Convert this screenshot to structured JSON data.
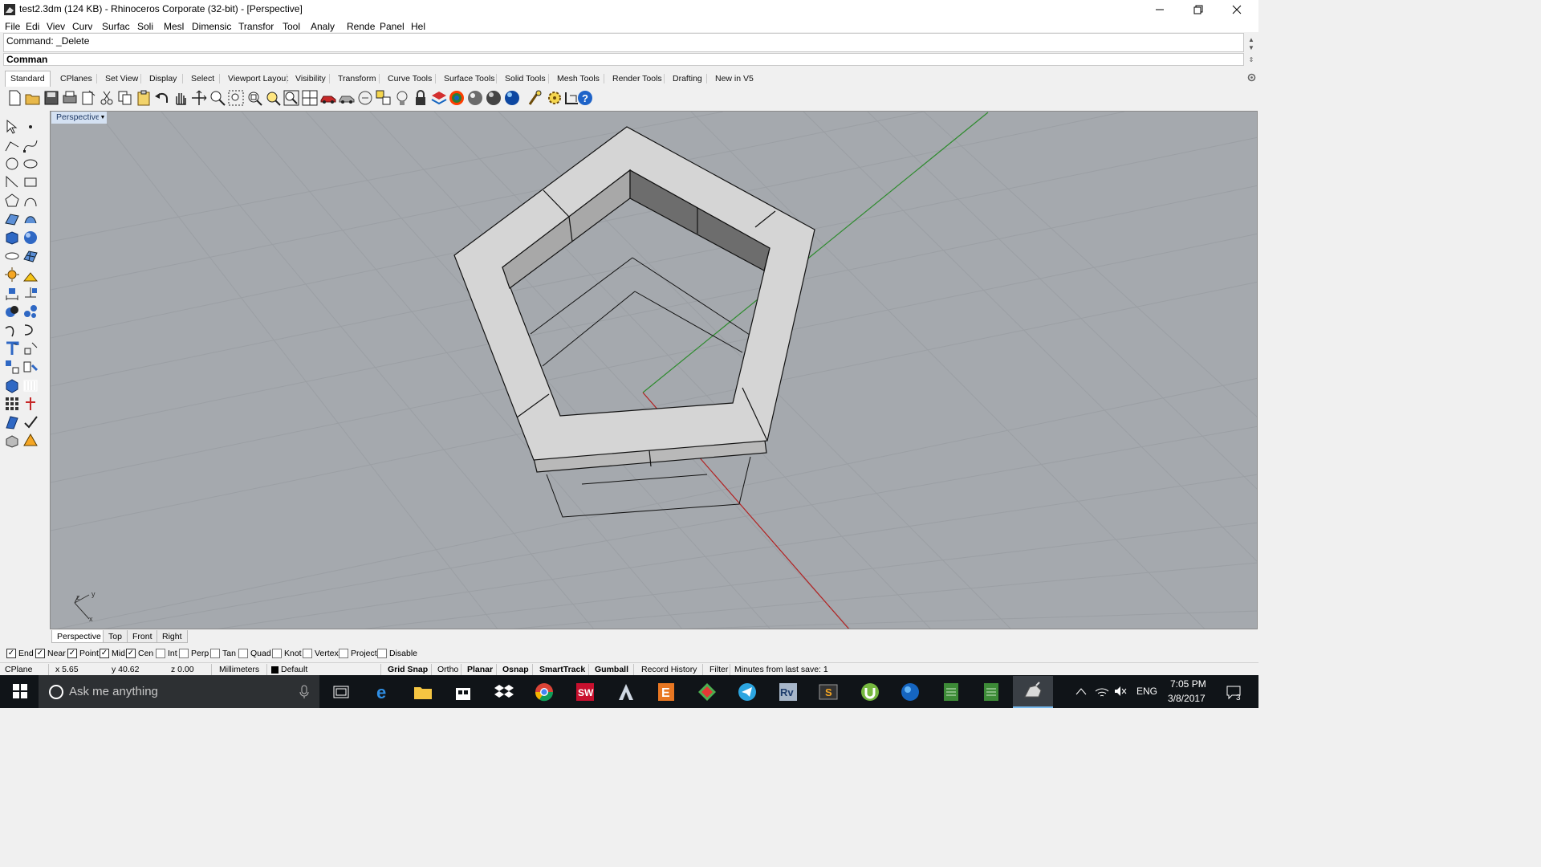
{
  "window": {
    "title": "test2.3dm (124 KB) - Rhinoceros Corporate (32-bit) - [Perspective]",
    "controls": [
      "minimize",
      "restore",
      "close"
    ]
  },
  "menu": [
    "File",
    "Edit",
    "View",
    "Curve",
    "Surface",
    "Solid",
    "Mesh",
    "Dimension",
    "Transform",
    "Tools",
    "Analyze",
    "Render",
    "Panel",
    "Help"
  ],
  "menu_visible": [
    "File",
    "Edi",
    "Viev",
    "Curv",
    "Surfac",
    "Soli",
    "Mesl",
    "Dimensic",
    "Transfor",
    "Tool",
    "Analy",
    "Rende",
    "Panel",
    "Hel"
  ],
  "command": {
    "history": "Command: _Delete",
    "prompt": "Comman"
  },
  "toolbar_tabs": [
    "Standard",
    "CPlanes",
    "Set View",
    "Display",
    "Select",
    "Viewport Layout",
    "Visibility",
    "Transform",
    "Curve Tools",
    "Surface Tools",
    "Solid Tools",
    "Mesh Tools",
    "Render Tools",
    "Drafting",
    "New in V5"
  ],
  "active_tab": "Standard",
  "viewport": {
    "label": "Perspective",
    "axis_labels": {
      "y": "y",
      "z": "z",
      "x": "x"
    }
  },
  "viewport_tabs": [
    "Perspective",
    "Top",
    "Front",
    "Right"
  ],
  "active_viewport_tab": "Perspective",
  "osnaps": [
    {
      "label": "End",
      "checked": true
    },
    {
      "label": "Near",
      "checked": true
    },
    {
      "label": "Point",
      "checked": true
    },
    {
      "label": "Mid",
      "checked": true
    },
    {
      "label": "Cen",
      "checked": true
    },
    {
      "label": "Int",
      "checked": false
    },
    {
      "label": "Perp",
      "checked": false
    },
    {
      "label": "Tan",
      "checked": false
    },
    {
      "label": "Quad",
      "checked": false
    },
    {
      "label": "Knot",
      "checked": false
    },
    {
      "label": "Vertex",
      "checked": false
    },
    {
      "label": "Project",
      "checked": false
    },
    {
      "label": "Disable",
      "checked": false
    }
  ],
  "status": {
    "cplane": "CPlane",
    "x": "x 5.65",
    "y": "y 40.62",
    "z": "z 0.00",
    "units": "Millimeters",
    "layer": "Default",
    "grid_snap": "Grid Snap",
    "ortho": "Ortho",
    "planar": "Planar",
    "osnap": "Osnap",
    "smarttrack": "SmartTrack",
    "gumball": "Gumball",
    "record_history": "Record History",
    "filter": "Filter",
    "autosave": "Minutes from last save: 1"
  },
  "taskbar": {
    "search_placeholder": "Ask me anything",
    "language": "ENG",
    "time": "7:05 PM",
    "date": "3/8/2017",
    "notification_count": "3"
  },
  "colors": {
    "viewport_bg": "#a5a9ae",
    "grid_line": "#9a9ea3",
    "x_axis": "#b22222",
    "y_axis": "#2e8b2e",
    "taskbar": "#101418",
    "active_viewport_label": "#d4e1f2"
  }
}
